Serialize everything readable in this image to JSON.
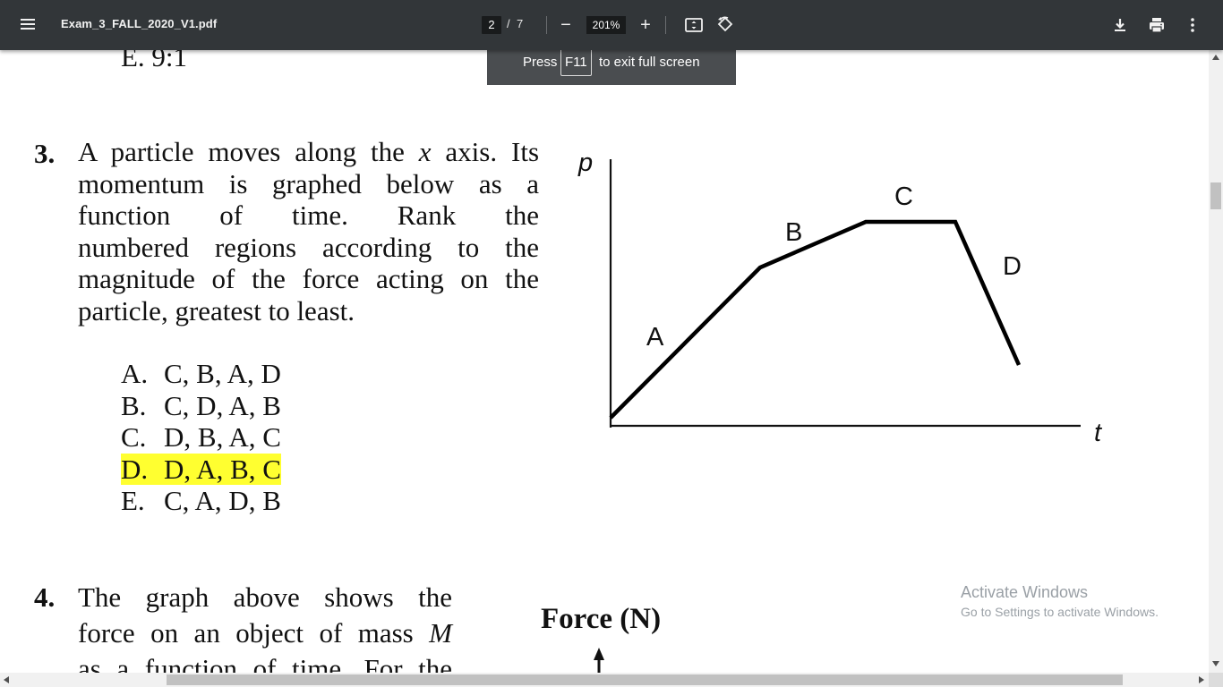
{
  "toolbar": {
    "file_name": "Exam_3_FALL_2020_V1.pdf",
    "page_current": "2",
    "page_separator": "/",
    "page_total": "7",
    "zoom_level": "201%",
    "zoom_out_label": "−",
    "zoom_in_label": "+",
    "icons": [
      "menu-icon",
      "fit-page-icon",
      "rotate-icon",
      "download-icon",
      "print-icon",
      "more-options-icon"
    ]
  },
  "fullscreen_toast": {
    "before": "Press",
    "key": "F11",
    "after": "to exit full screen"
  },
  "document": {
    "prev_option_tail": "E.  9:1",
    "question3": {
      "number": "3.",
      "lines": [
        "A particle moves along the x axis. Its",
        "momentum is graphed below as a",
        "function of time. Rank the",
        "numbered regions according to the",
        "magnitude of the force acting on the",
        "particle, greatest to least."
      ],
      "options": [
        {
          "letter": "A.",
          "text": "C, B, A, D",
          "highlighted": false
        },
        {
          "letter": "B.",
          "text": "C, D, A, B",
          "highlighted": false
        },
        {
          "letter": "C.",
          "text": "D, B, A, C",
          "highlighted": false
        },
        {
          "letter": "D.",
          "text": "D, A, B, C",
          "highlighted": true
        },
        {
          "letter": "E.",
          "text": "C, A, D, B",
          "highlighted": false
        }
      ],
      "graph": {
        "y_axis_label": "p",
        "x_axis_label": "t",
        "region_labels": [
          "A",
          "B",
          "C",
          "D"
        ]
      }
    },
    "question4": {
      "number": "4.",
      "lines": [
        "The graph above shows the",
        "force on an object of mass M",
        "as a function of time. For the"
      ],
      "graph_label": "Force (N)"
    }
  },
  "watermark": {
    "line1": "Activate Windows",
    "line2": "Go to Settings to activate Windows."
  },
  "colors": {
    "toolbar_bg": "#323639",
    "highlight": "#ffff30",
    "toast_bg": "#4a4d50"
  }
}
